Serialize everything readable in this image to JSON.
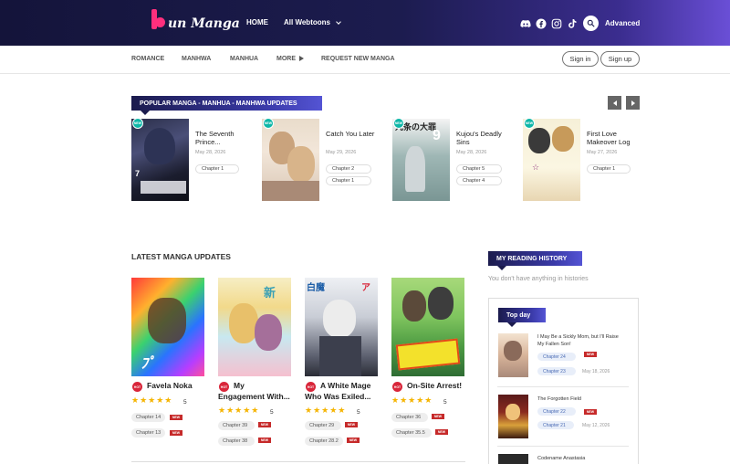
{
  "header": {
    "logo_text": "un Manga",
    "nav": {
      "home": "HOME",
      "webtoons": "All Webtoons"
    },
    "social_icons": [
      "discord-icon",
      "facebook-icon",
      "instagram-icon",
      "tiktok-icon"
    ],
    "advanced_label": "Advanced"
  },
  "subnav": {
    "items": [
      "ROMANCE",
      "MANHWA",
      "MANHUA",
      "MORE",
      "REQUEST NEW MANGA"
    ],
    "signin": "Sign in",
    "signup": "Sign up"
  },
  "popular": {
    "heading": "POPULAR MANGA - MANHUA - MANHWA UPDATES",
    "badge": "NEW",
    "items": [
      {
        "title": "The Seventh Prince...",
        "date": "May 28, 2026",
        "chapters": [
          "Chapter 1"
        ]
      },
      {
        "title": "Catch You Later",
        "date": "May 29, 2026",
        "chapters": [
          "Chapter 2",
          "Chapter 1"
        ]
      },
      {
        "title": "Kujou's Deadly Sins",
        "date": "May 28, 2026",
        "chapters": [
          "Chapter 5",
          "Chapter 4"
        ]
      },
      {
        "title": "First Love Makeover Log",
        "date": "May 27, 2026",
        "chapters": [
          "Chapter 1"
        ]
      }
    ]
  },
  "latest": {
    "heading": "LATEST MANGA UPDATES",
    "hot_badge": "HOT",
    "new_tag": "NEW",
    "items": [
      {
        "title_1": "Favela Noka",
        "title_2": "",
        "rating": "5",
        "chapters": [
          "Chapter 14",
          "Chapter 13"
        ]
      },
      {
        "title_1": "My",
        "title_2": "Engagement With...",
        "rating": "5",
        "chapters": [
          "Chapter 39",
          "Chapter 38"
        ]
      },
      {
        "title_1": "A White Mage",
        "title_2": "Who Was Exiled...",
        "rating": "5",
        "chapters": [
          "Chapter 29",
          "Chapter 28.2"
        ]
      },
      {
        "title_1": "On-Site Arrest!",
        "title_2": "",
        "rating": "5",
        "chapters": [
          "Chapter 36",
          "Chapter 35.5"
        ]
      }
    ]
  },
  "sidebar": {
    "history_heading": "MY READING HISTORY",
    "history_empty": "You don't have anything in histories",
    "topday_heading": "Top day",
    "new_tag": "NEW",
    "items": [
      {
        "title": "I May Be a Sickly Mom, but I'll Raise My Fallen Son!",
        "chapters": [
          "Chapter 24",
          "Chapter 23"
        ],
        "date": "May 18, 2026"
      },
      {
        "title": "The Forgotten Field",
        "chapters": [
          "Chapter 22",
          "Chapter 21"
        ],
        "date": "May 12, 2026"
      },
      {
        "title": "Codename Anastasia",
        "chapters": [],
        "date": ""
      }
    ]
  }
}
